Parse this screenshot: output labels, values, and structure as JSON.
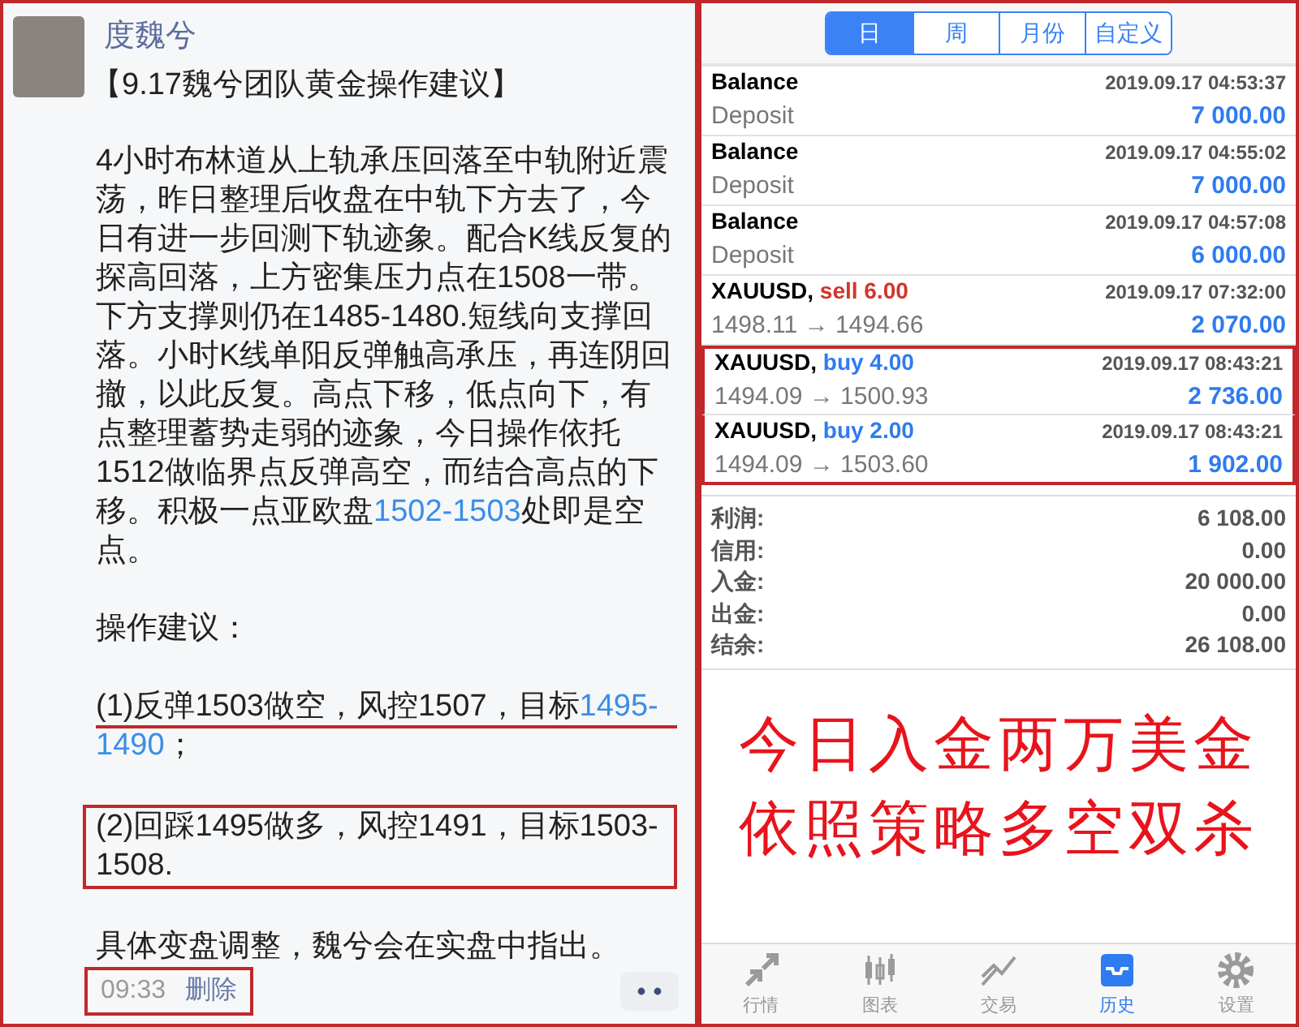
{
  "chat": {
    "author": "度魏兮",
    "title": "【9.17魏兮团队黄金操作建议】",
    "paragraphs": [
      {
        "kind": "plain",
        "segments": [
          {
            "text": "4小时布林道从上轨承压回落至中轨附近震荡，昨日整理后收盘在中轨下方去了，今日有进一步回测下轨迹象。配合K线反复的探高回落，上方密集压力点在1508一带。下方支撑则仍在1485-1480.短线向支撑回落。小时K线单阳反弹触高承压，再连阴回撤，以此反复。高点下移，低点向下，有点整理蓄势走弱的迹象，今日操作依托1512做临界点反弹高空，而结合高点的下移。积极一点亚欧盘",
            "link": false
          },
          {
            "text": "1502-1503",
            "link": true
          },
          {
            "text": "处即是空点。",
            "link": false
          }
        ]
      },
      {
        "kind": "plain",
        "segments": [
          {
            "text": "操作建议：",
            "link": false
          }
        ]
      },
      {
        "kind": "underlined",
        "segments": [
          {
            "text": "(1)反弹1503做空，风控1507，目标",
            "link": false
          },
          {
            "text": "1495-1490",
            "link": true
          },
          {
            "text": "；",
            "link": false
          }
        ]
      },
      {
        "kind": "boxed",
        "segments": [
          {
            "text": "(2)回踩1495做多，风控1491，目标1503-1508.",
            "link": false
          }
        ]
      },
      {
        "kind": "plain",
        "segments": [
          {
            "text": "具体变盘调整，魏兮会在实盘中指出。",
            "link": false
          }
        ]
      }
    ],
    "footer": {
      "time": "09:33",
      "delete": "删除",
      "boxed": true
    }
  },
  "history": {
    "tabs": [
      {
        "label": "日",
        "selected": true
      },
      {
        "label": "周",
        "selected": false
      },
      {
        "label": "月份",
        "selected": false
      },
      {
        "label": "自定义",
        "selected": false
      }
    ],
    "rows": [
      {
        "kind": "balance",
        "symbol": "Balance",
        "detail": "Deposit",
        "time": "2019.09.17 04:53:37",
        "amount": "7 000.00",
        "highlighted": false
      },
      {
        "kind": "balance",
        "symbol": "Balance",
        "detail": "Deposit",
        "time": "2019.09.17 04:55:02",
        "amount": "7 000.00",
        "highlighted": false
      },
      {
        "kind": "balance",
        "symbol": "Balance",
        "detail": "Deposit",
        "time": "2019.09.17 04:57:08",
        "amount": "6 000.00",
        "highlighted": false
      },
      {
        "kind": "sell",
        "symbol": "XAUUSD,",
        "side": "sell 6.00",
        "detail": "1498.11 → 1494.66",
        "time": "2019.09.17 07:32:00",
        "amount": "2 070.00",
        "highlighted": false
      },
      {
        "kind": "buy",
        "symbol": "XAUUSD,",
        "side": "buy 4.00",
        "detail": "1494.09 → 1500.93",
        "time": "2019.09.17 08:43:21",
        "amount": "2 736.00",
        "highlighted": true
      },
      {
        "kind": "buy",
        "symbol": "XAUUSD,",
        "side": "buy 2.00",
        "detail": "1494.09 → 1503.60",
        "time": "2019.09.17 08:43:21",
        "amount": "1 902.00",
        "highlighted": true
      }
    ],
    "summary": [
      {
        "label": "利润:",
        "value": "6 108.00"
      },
      {
        "label": "信用:",
        "value": "0.00"
      },
      {
        "label": "入金:",
        "value": "20 000.00"
      },
      {
        "label": "出金:",
        "value": "0.00"
      },
      {
        "label": "结余:",
        "value": "26 108.00"
      }
    ],
    "annotation": [
      "今日入金两万美金",
      "依照策略多空双杀"
    ],
    "tabbar": [
      {
        "label": "行情",
        "selected": false
      },
      {
        "label": "图表",
        "selected": false
      },
      {
        "label": "交易",
        "selected": false
      },
      {
        "label": "历史",
        "selected": true
      },
      {
        "label": "设置",
        "selected": false
      }
    ]
  }
}
